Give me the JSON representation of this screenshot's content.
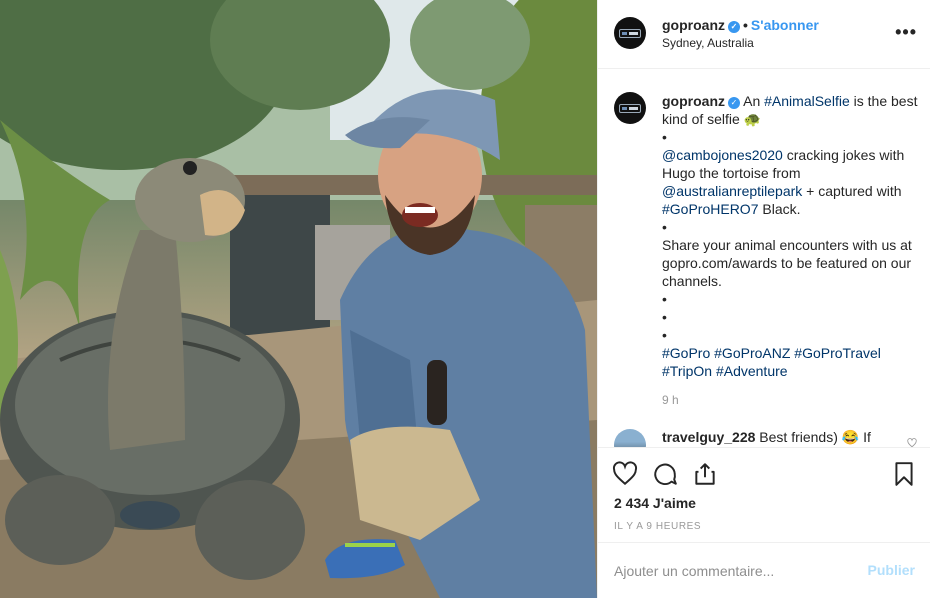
{
  "photo": {
    "alt_subject": "tortoise-and-man-selfie"
  },
  "header": {
    "username": "goproanz",
    "verified_icon": "verified-check-icon",
    "separator": "•",
    "follow_label": "S'abonner",
    "location": "Sydney, Australia",
    "more_icon": "more-options-icon"
  },
  "caption": {
    "username": "goproanz",
    "seg1": "An ",
    "hashtag_animalselfie": "#AnimalSelfie",
    "seg2": " is the best kind of selfie ",
    "emoji_turtle": "🐢",
    "bullet": "•",
    "mention_cambo": "@cambojones2020",
    "seg3": " cracking jokes with Hugo the tortoise from ",
    "mention_reptile": "@australianreptilepark",
    "seg4": " + captured with ",
    "hashtag_hero7": "#GoProHERO7",
    "seg5": " Black.",
    "seg6": "Share your animal encounters with us at gopro.com/awards to be featured on our channels.",
    "hashtags": [
      "#GoPro",
      "#GoProANZ",
      "#GoProTravel",
      "#TripOn",
      "#Adventure"
    ],
    "time": "9 h"
  },
  "comment2": {
    "username": "travelguy_228",
    "text": " Best friends) 😂 If"
  },
  "actions": {
    "like_icon": "heart-icon",
    "comment_icon": "comment-icon",
    "share_icon": "share-icon",
    "save_icon": "bookmark-icon",
    "likes": "2 434 J'aime",
    "time_ago": "IL Y A 9 HEURES"
  },
  "add_comment": {
    "placeholder": "Ajouter un commentaire...",
    "publish_label": "Publier"
  },
  "colors": {
    "link": "#003569",
    "accent": "#3897f0",
    "publish_disabled": "#b2dffc",
    "muted": "#999999"
  }
}
